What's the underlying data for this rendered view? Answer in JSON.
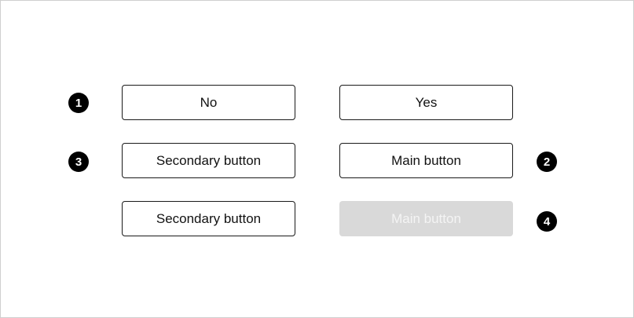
{
  "buttons": {
    "no": "No",
    "yes": "Yes",
    "secondary_1": "Secondary button",
    "main_1": "Main button",
    "secondary_2": "Secondary button",
    "main_2_disabled": "Main button"
  },
  "badges": {
    "one": "1",
    "two": "2",
    "three": "3",
    "four": "4"
  },
  "colors": {
    "border": "#1a1a1a",
    "disabled_bg": "#d9d9d9",
    "disabled_text": "#f4f4f4",
    "badge_bg": "#000000"
  }
}
